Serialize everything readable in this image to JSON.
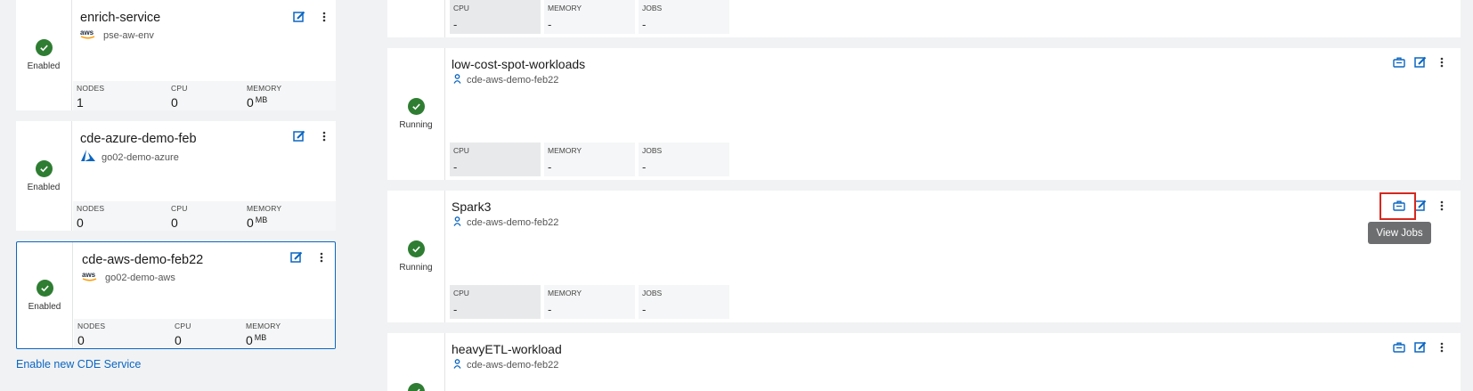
{
  "service_cards": [
    {
      "name": "enrich-service",
      "status": "Enabled",
      "provider_icon": "aws-icon",
      "env": "pse-aw-env",
      "metrics": [
        {
          "label": "NODES",
          "value": "1"
        },
        {
          "label": "CPU",
          "value": "0"
        },
        {
          "label": "MEMORY",
          "value": "0",
          "unit": "MB"
        }
      ]
    },
    {
      "name": "cde-azure-demo-feb",
      "status": "Enabled",
      "provider_icon": "azure-icon",
      "env": "go02-demo-azure",
      "metrics": [
        {
          "label": "NODES",
          "value": "0"
        },
        {
          "label": "CPU",
          "value": "0"
        },
        {
          "label": "MEMORY",
          "value": "0",
          "unit": "MB"
        }
      ]
    },
    {
      "name": "cde-aws-demo-feb22",
      "status": "Enabled",
      "provider_icon": "aws-icon",
      "env": "go02-demo-aws",
      "metrics": [
        {
          "label": "NODES",
          "value": "0"
        },
        {
          "label": "CPU",
          "value": "0"
        },
        {
          "label": "MEMORY",
          "value": "0",
          "unit": "MB"
        }
      ]
    }
  ],
  "enable_link": "Enable new CDE Service",
  "virtual_clusters": [
    {
      "name": "",
      "status": "",
      "service": "",
      "metrics": [
        {
          "label": "CPU",
          "value": "-"
        },
        {
          "label": "MEMORY",
          "value": "-"
        },
        {
          "label": "JOBS",
          "value": "-"
        }
      ]
    },
    {
      "name": "low-cost-spot-workloads",
      "status": "Running",
      "service": "cde-aws-demo-feb22",
      "metrics": [
        {
          "label": "CPU",
          "value": "-"
        },
        {
          "label": "MEMORY",
          "value": "-"
        },
        {
          "label": "JOBS",
          "value": "-"
        }
      ]
    },
    {
      "name": "Spark3",
      "status": "Running",
      "service": "cde-aws-demo-feb22",
      "metrics": [
        {
          "label": "CPU",
          "value": "-"
        },
        {
          "label": "MEMORY",
          "value": "-"
        },
        {
          "label": "JOBS",
          "value": "-"
        }
      ]
    },
    {
      "name": "heavyETL-workload",
      "status": "",
      "service": "cde-aws-demo-feb22"
    }
  ],
  "tooltip": "View Jobs",
  "colors": {
    "accent": "#0a66c2",
    "success": "#2e7d32",
    "highlight": "#d6281e"
  }
}
